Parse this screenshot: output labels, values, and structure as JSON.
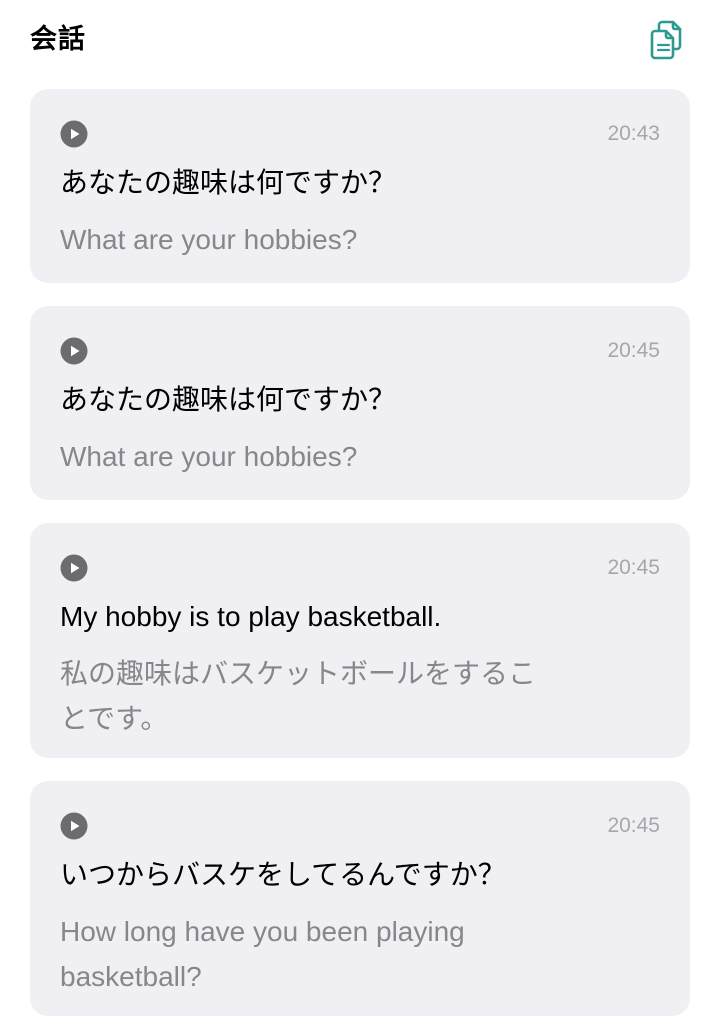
{
  "header": {
    "title": "会話",
    "copy_icon": "copy-documents-icon",
    "accent_color": "#2e9a8f"
  },
  "messages": [
    {
      "play_icon": "play-icon",
      "time": "20:43",
      "primary": "あなたの趣味は何ですか？",
      "secondary": "What are your hobbies?"
    },
    {
      "play_icon": "play-icon",
      "time": "20:45",
      "primary": "あなたの趣味は何ですか？",
      "secondary": "What are your hobbies?"
    },
    {
      "play_icon": "play-icon",
      "time": "20:45",
      "primary": "My hobby is to play basketball.",
      "secondary": "私の趣味はバスケットボールをすることです。"
    },
    {
      "play_icon": "play-icon",
      "time": "20:45",
      "primary": "いつからバスケをしてるんですか？",
      "secondary": "How long have you been playing basketball?"
    }
  ],
  "colors": {
    "card_background": "#f0eff4",
    "secondary_text": "#86868b",
    "timestamp_text": "#a6a6ab",
    "play_icon": "#6c6c70"
  }
}
